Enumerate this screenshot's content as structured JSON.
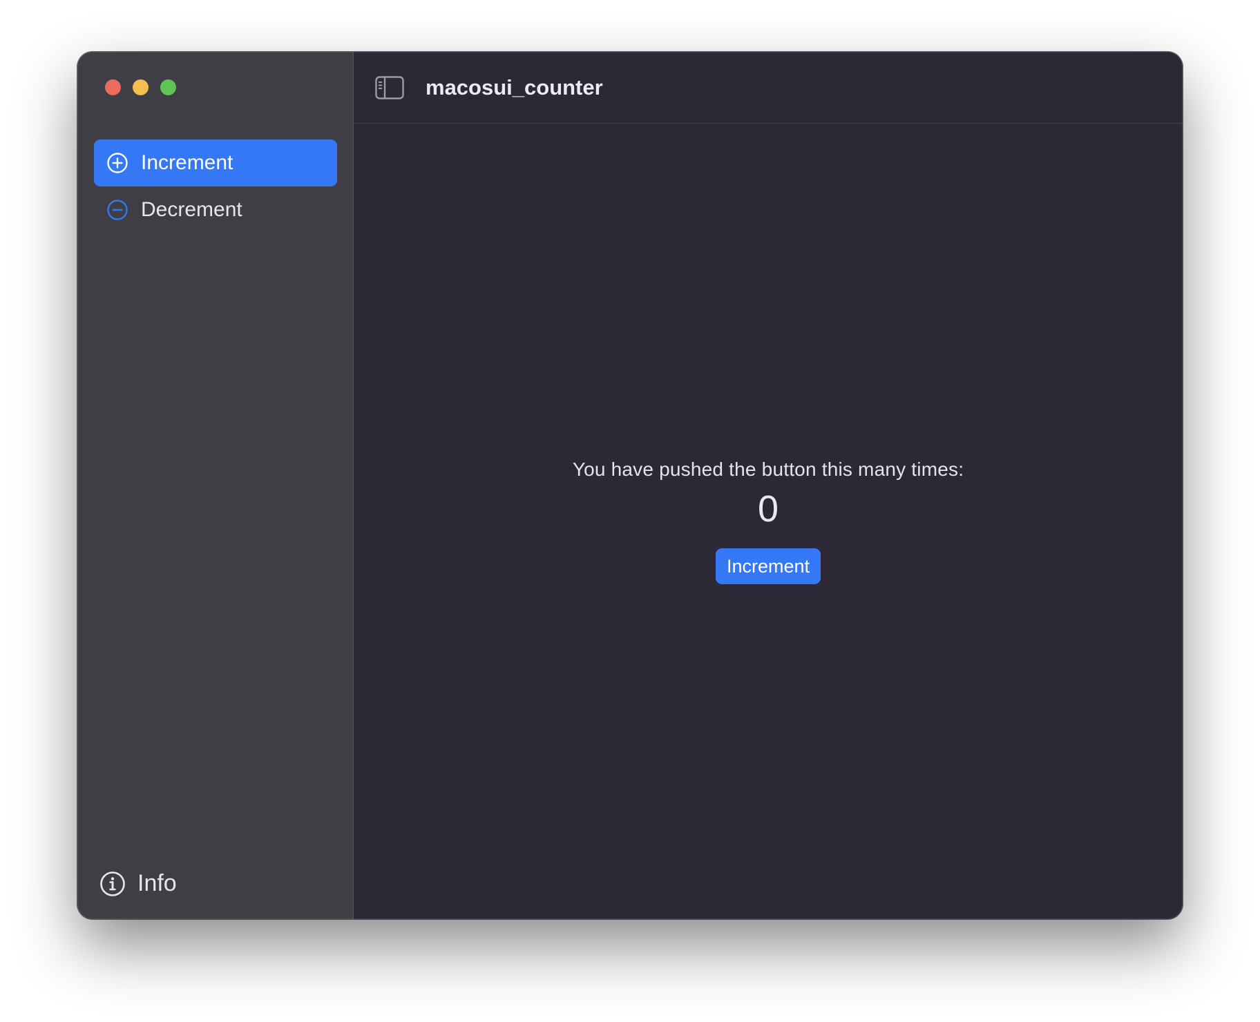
{
  "window": {
    "title": "macosui_counter"
  },
  "traffic_lights": {
    "close": "#ed6a5e",
    "minimize": "#f5bf4f",
    "maximize": "#61c554"
  },
  "sidebar": {
    "items": [
      {
        "label": "Increment",
        "icon": "plus-circle-icon",
        "selected": true
      },
      {
        "label": "Decrement",
        "icon": "minus-circle-icon",
        "selected": false
      }
    ],
    "footer": {
      "label": "Info",
      "icon": "info-circle-icon"
    }
  },
  "main": {
    "message": "You have pushed the button this many times:",
    "count": "0",
    "button_label": "Increment"
  },
  "colors": {
    "accent": "#3478f6",
    "sidebar_bg": "#3f3e44",
    "content_bg": "#2d2835"
  }
}
